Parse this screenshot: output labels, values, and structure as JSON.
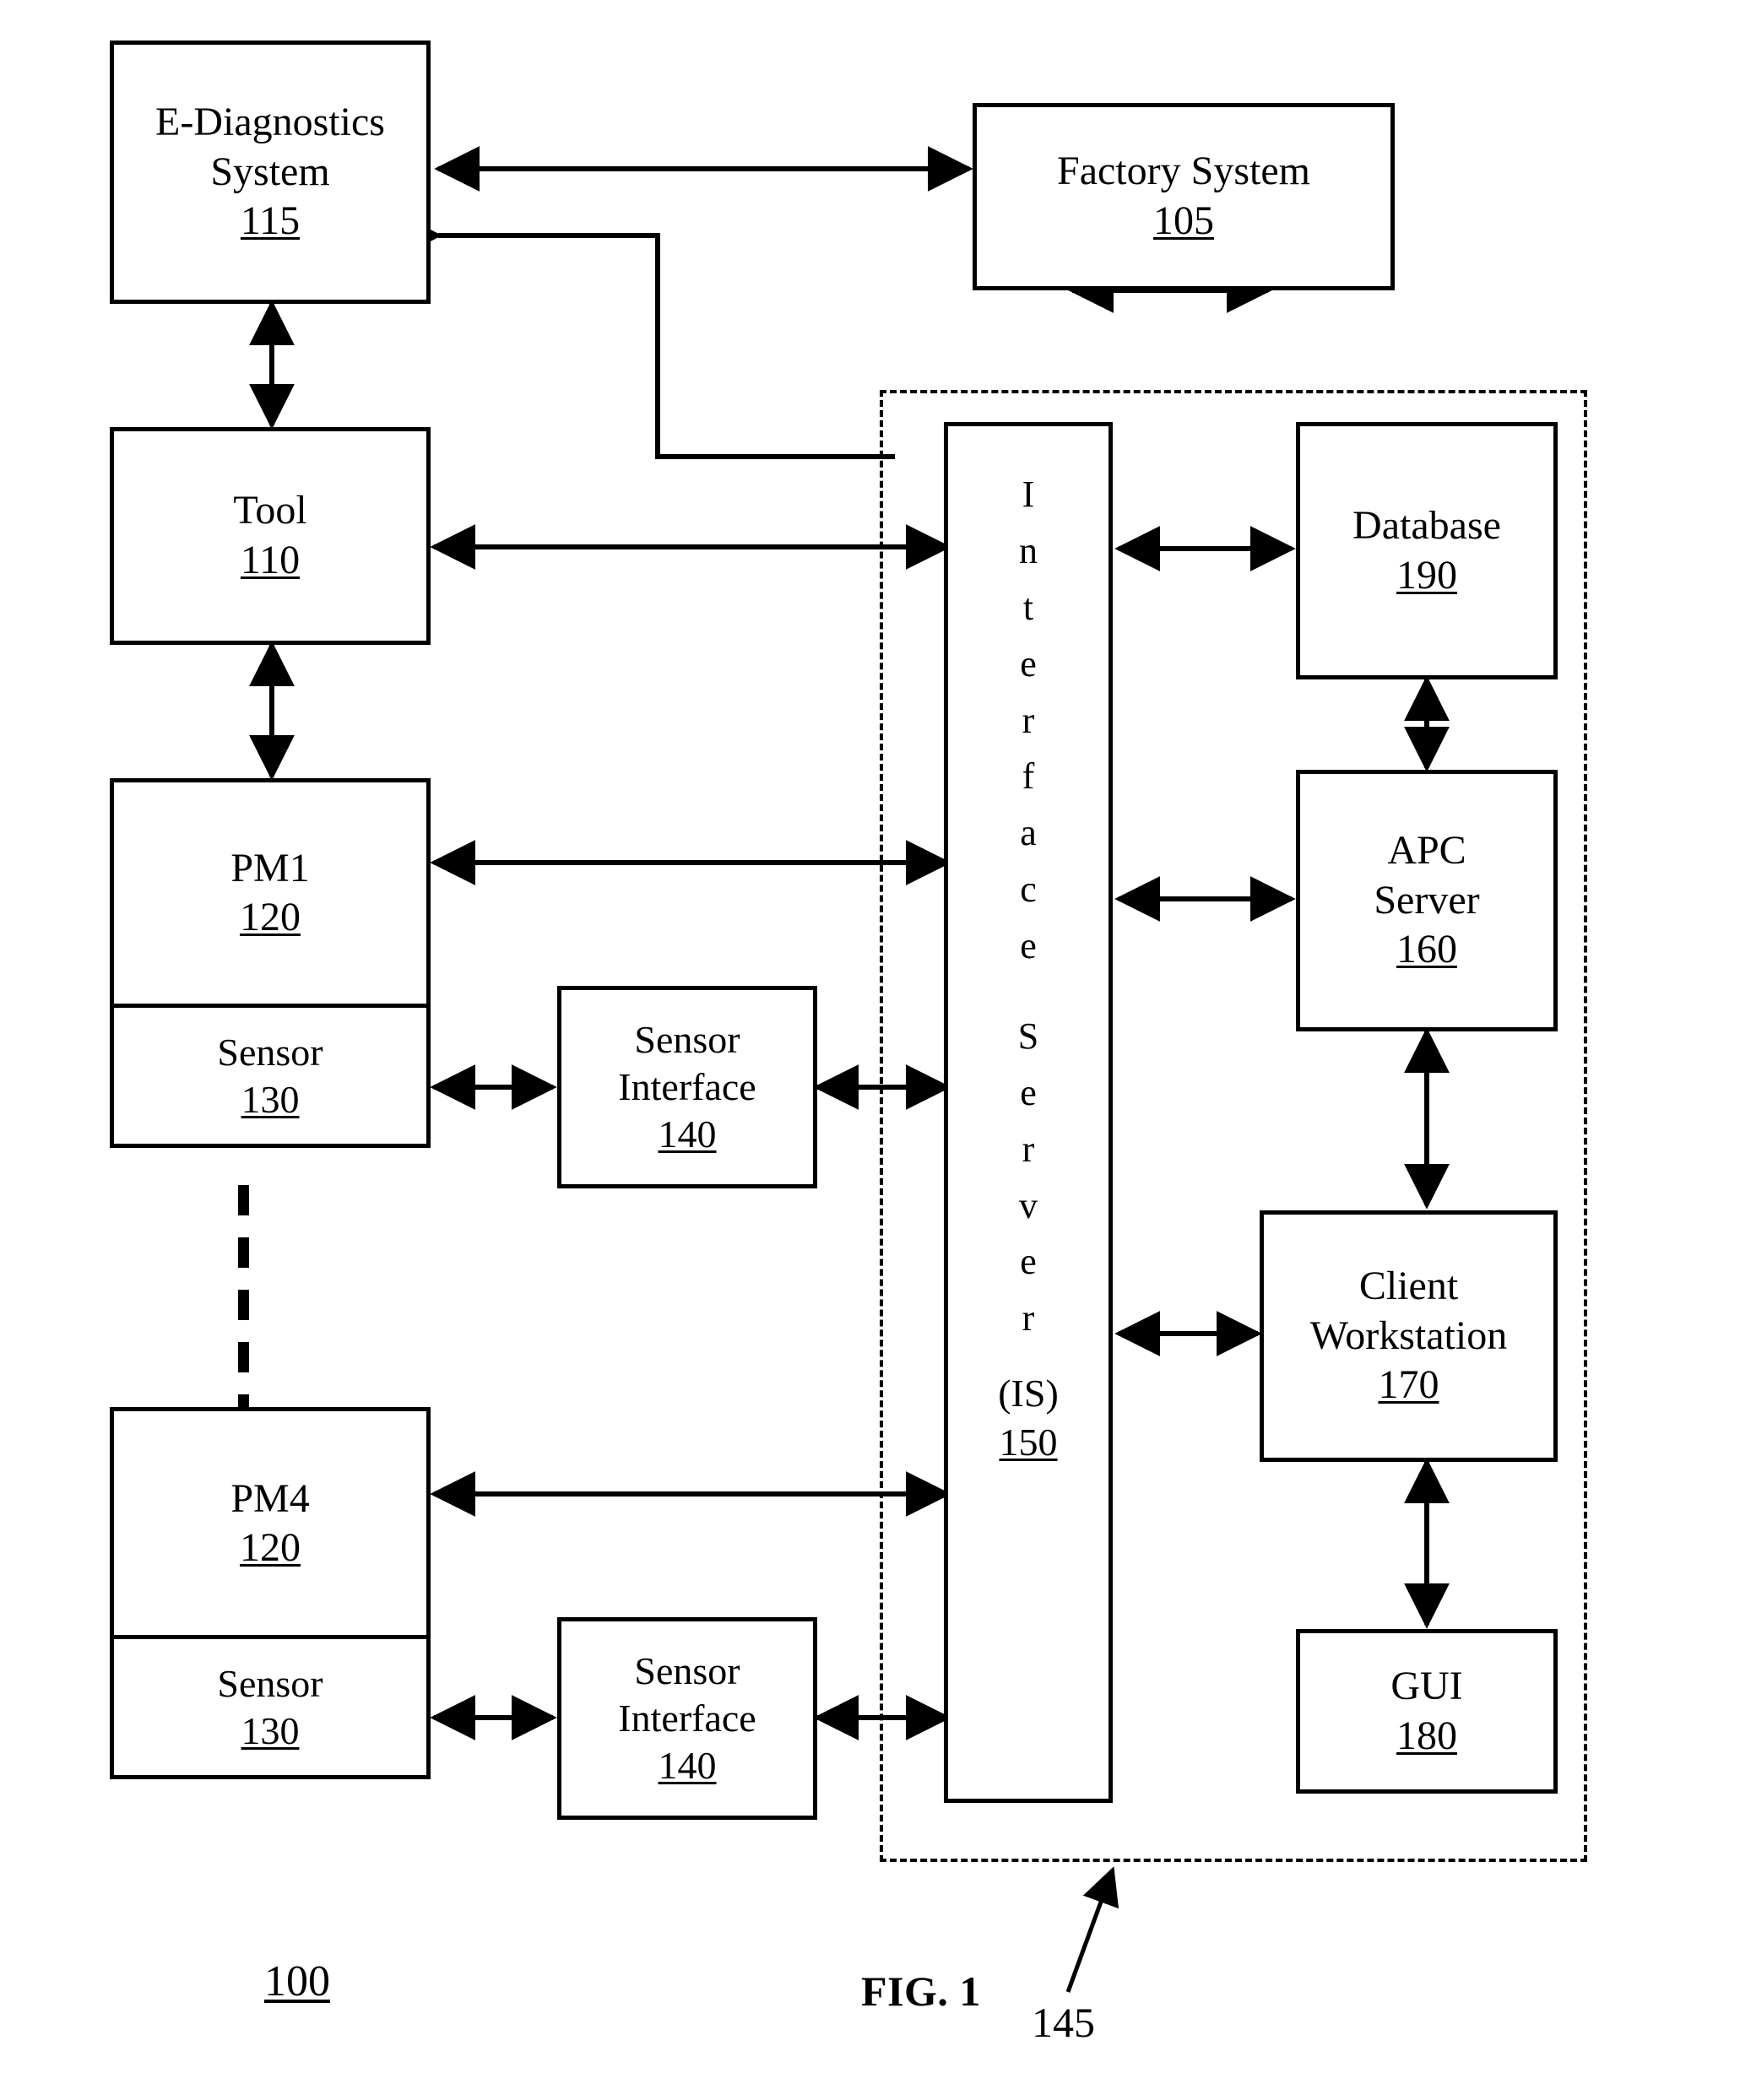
{
  "figure": {
    "caption": "FIG. 1",
    "system_ref": "100",
    "callout_ref": "145"
  },
  "nodes": {
    "ediag": {
      "title": "E-Diagnostics\nSystem",
      "ref": "115"
    },
    "factory": {
      "title": "Factory System",
      "ref": "105"
    },
    "tool": {
      "title": "Tool",
      "ref": "110"
    },
    "pm1": {
      "title": "PM1",
      "ref": "120"
    },
    "pm1_sensor": {
      "title": "Sensor",
      "ref": "130"
    },
    "pm4": {
      "title": "PM4",
      "ref": "120"
    },
    "pm4_sensor": {
      "title": "Sensor",
      "ref": "130"
    },
    "sensor_if_1": {
      "title": "Sensor\nInterface",
      "ref": "140"
    },
    "sensor_if_2": {
      "title": "Sensor\nInterface",
      "ref": "140"
    },
    "interface_server": {
      "letters": [
        "I",
        "n",
        "t",
        "e",
        "r",
        "f",
        "a",
        "c",
        "e",
        "S",
        "e",
        "r",
        "v",
        "e",
        "r"
      ],
      "abbrev": "(IS)",
      "ref": "150"
    },
    "database": {
      "title": "Database",
      "ref": "190"
    },
    "apc": {
      "title": "APC\nServer",
      "ref": "160"
    },
    "client": {
      "title": "Client\nWorkstation",
      "ref": "170"
    },
    "gui": {
      "title": "GUI",
      "ref": "180"
    }
  },
  "connections": [
    {
      "from": "ediag",
      "to": "factory",
      "kind": "bidirectional"
    },
    {
      "from": "interface_server",
      "to": "ediag",
      "kind": "directed-elbow"
    },
    {
      "from": "factory",
      "to": "dashzone",
      "kind": "bidirectional"
    },
    {
      "from": "ediag",
      "to": "tool",
      "kind": "bidirectional"
    },
    {
      "from": "tool",
      "to": "interface_server",
      "kind": "bidirectional"
    },
    {
      "from": "tool",
      "to": "pm1",
      "kind": "bidirectional"
    },
    {
      "from": "pm1",
      "to": "interface_server",
      "kind": "bidirectional"
    },
    {
      "from": "pm1_sensor",
      "to": "sensor_if_1",
      "kind": "bidirectional"
    },
    {
      "from": "sensor_if_1",
      "to": "interface_server",
      "kind": "bidirectional"
    },
    {
      "from": "pm4",
      "to": "interface_server",
      "kind": "bidirectional"
    },
    {
      "from": "pm4_sensor",
      "to": "sensor_if_2",
      "kind": "bidirectional"
    },
    {
      "from": "sensor_if_2",
      "to": "interface_server",
      "kind": "bidirectional"
    },
    {
      "from": "interface_server",
      "to": "database",
      "kind": "bidirectional"
    },
    {
      "from": "interface_server",
      "to": "apc",
      "kind": "bidirectional"
    },
    {
      "from": "interface_server",
      "to": "client",
      "kind": "bidirectional"
    },
    {
      "from": "database",
      "to": "apc",
      "kind": "bidirectional"
    },
    {
      "from": "apc",
      "to": "client",
      "kind": "bidirectional"
    },
    {
      "from": "client",
      "to": "gui",
      "kind": "bidirectional"
    }
  ],
  "style": {
    "stroke": "#000000",
    "background": "#ffffff"
  }
}
